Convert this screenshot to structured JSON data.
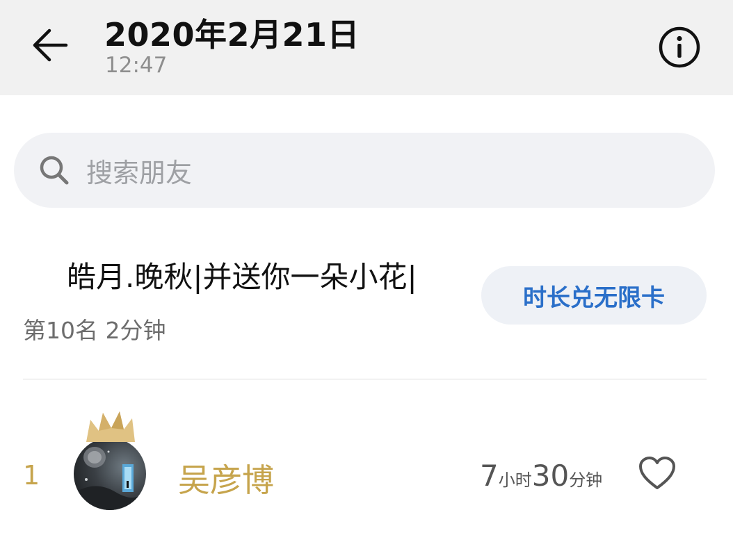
{
  "header": {
    "title": "2020年2月21日",
    "subtitle": "12:47",
    "back_icon": "arrow-left-icon",
    "info_icon": "info-circle-icon"
  },
  "search": {
    "placeholder": "搜索朋友",
    "icon": "search-icon"
  },
  "my_rank": {
    "name": "皓月.晚秋|并送你一朵小花|",
    "rank_text": "第10名 2分钟",
    "card_button_label": "时长兑无限卡"
  },
  "leaderboard": {
    "rows": [
      {
        "rank": "1",
        "name": "吴彦博",
        "hours": "7",
        "hours_unit": "小时",
        "minutes": "30",
        "minutes_unit": "分钟",
        "like_icon": "heart-icon",
        "badge_icon": "crown-icon"
      }
    ]
  },
  "colors": {
    "header_bg": "#f1f1f1",
    "accent_blue": "#2a6fc9",
    "gold": "#c6a44c",
    "search_bg": "#f1f2f5"
  }
}
